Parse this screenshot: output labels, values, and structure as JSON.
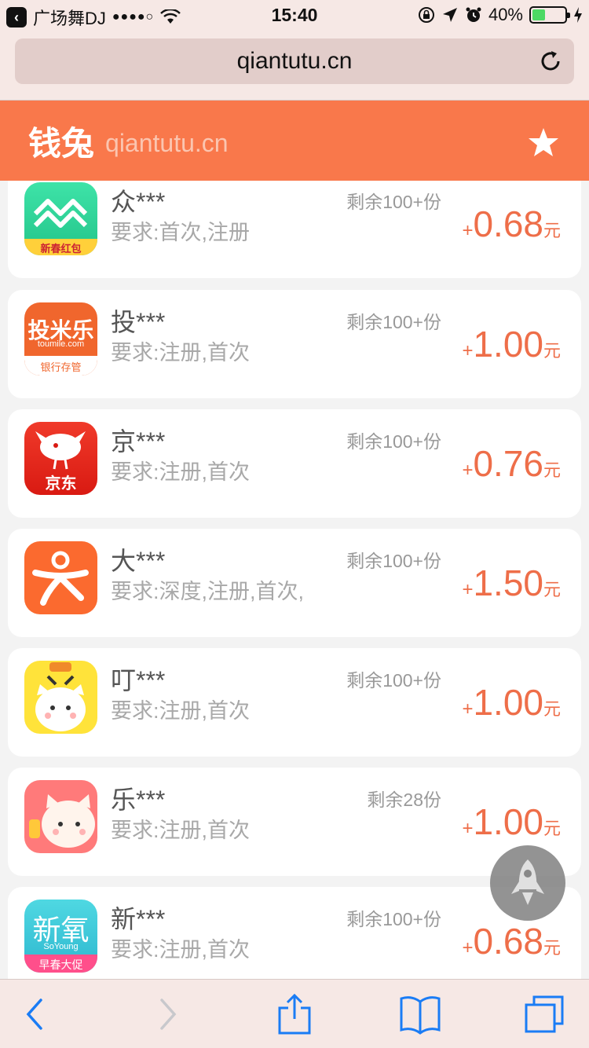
{
  "status_bar": {
    "carrier": "广场舞DJ",
    "signal": "●●●●○",
    "time": "15:40",
    "battery": "40%",
    "battery_level": 0.4
  },
  "browser": {
    "url": "qiantutu.cn"
  },
  "site": {
    "name": "钱兔",
    "domain": "qiantutu.cn"
  },
  "offers": [
    {
      "name": "众***",
      "requirement": "要求:首次,注册",
      "remaining": "剩余100+份",
      "plus": "+",
      "amount": "0.68",
      "unit": "元",
      "icon": "zhong-app-icon",
      "icon_color": "#2fcf8f",
      "icon_badge": "新春红包"
    },
    {
      "name": "投***",
      "requirement": "要求:注册,首次",
      "remaining": "剩余100+份",
      "plus": "+",
      "amount": "1.00",
      "unit": "元",
      "icon": "toumile-app-icon",
      "icon_color": "#f0662d",
      "icon_title": "投米乐",
      "icon_sub": "toumile.com",
      "icon_badge": "银行存管"
    },
    {
      "name": "京***",
      "requirement": "要求:注册,首次",
      "remaining": "剩余100+份",
      "plus": "+",
      "amount": "0.76",
      "unit": "元",
      "icon": "jd-app-icon",
      "icon_color": "#e4231b",
      "icon_badge": "京东"
    },
    {
      "name": "大***",
      "requirement": "要求:深度,注册,首次,",
      "remaining": "剩余100+份",
      "plus": "+",
      "amount": "1.50",
      "unit": "元",
      "icon": "dazhong-app-icon",
      "icon_color": "#fb6a2f"
    },
    {
      "name": "叮***",
      "requirement": "要求:注册,首次",
      "remaining": "剩余100+份",
      "plus": "+",
      "amount": "1.00",
      "unit": "元",
      "icon": "ding-cat-app-icon",
      "icon_color": "#ffe33a"
    },
    {
      "name": "乐***",
      "requirement": "要求:注册,首次",
      "remaining": "剩余28份",
      "plus": "+",
      "amount": "1.00",
      "unit": "元",
      "icon": "le-cat-app-icon",
      "icon_color": "#ff7a7a"
    },
    {
      "name": "新***",
      "requirement": "要求:注册,首次",
      "remaining": "剩余100+份",
      "plus": "+",
      "amount": "0.68",
      "unit": "元",
      "icon": "soyoung-app-icon",
      "icon_color": "#35c8d6",
      "icon_title": "新氧",
      "icon_sub": "SoYoung",
      "icon_badge": "早春大促"
    }
  ],
  "colors": {
    "accent": "#f9784b",
    "reward": "#ee6e49",
    "chrome": "#f6e8e5"
  }
}
